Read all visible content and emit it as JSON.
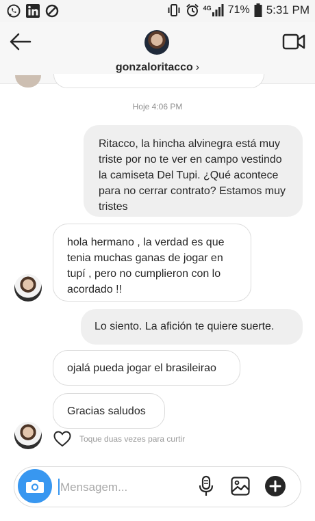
{
  "status_bar": {
    "battery": "71%",
    "time": "5:31 PM",
    "network": "4G",
    "left_icons": [
      "whatsapp-icon",
      "linkedin-icon",
      "blocked-icon"
    ],
    "right_icons": [
      "vibrate-icon",
      "alarm-icon",
      "signal-icon",
      "battery-icon"
    ]
  },
  "header": {
    "username": "gonzaloritacco",
    "chevron": "›",
    "back_icon": "arrow-left-icon",
    "video_icon": "video-camera-icon"
  },
  "timestamp": "Hoje 4:06 PM",
  "messages": [
    {
      "direction": "out",
      "text": "Ritacco, la hincha alvinegra está muy triste por no te ver en campo vestindo la camiseta Del Tupi. ¿Qué acontece para no cerrar contrato? Estamos muy tristes"
    },
    {
      "direction": "in",
      "text": "hola hermano , la verdad es que tenia muchas ganas de jogar en tupí , pero no cumplieron con lo acordado !!"
    },
    {
      "direction": "out",
      "text": "Lo siento. La afición te quiere suerte."
    },
    {
      "direction": "in",
      "text": "ojalá pueda jogar el brasileirao"
    },
    {
      "direction": "in",
      "text": "Gracias saludos"
    }
  ],
  "like_hint": "Toque duas vezes para curtir",
  "composer": {
    "placeholder": "Mensagem...",
    "value": "",
    "icons": [
      "camera-icon",
      "microphone-icon",
      "gallery-icon",
      "plus-icon"
    ]
  },
  "colors": {
    "accent": "#3897f0",
    "outgoing_bubble": "#efefef",
    "incoming_border": "#dbdbdb",
    "text": "#262626",
    "muted": "#8e8e8e"
  }
}
